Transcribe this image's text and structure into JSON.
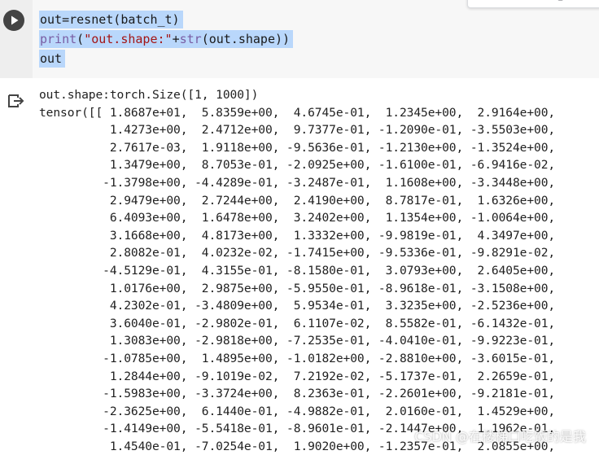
{
  "code_cell": {
    "lines": {
      "l1": "out=resnet(batch_t)",
      "l2a": "print",
      "l2b": "(",
      "l2c": "\"out.shape:\"",
      "l2d": "+",
      "l2e": "str",
      "l2f": "(out.shape))",
      "l3": "out"
    }
  },
  "output": {
    "text": "out.shape:torch.Size([1, 1000])\ntensor([[ 1.8687e+01,  5.8359e+00,  4.6745e-01,  1.2345e+00,  2.9164e+00,\n          1.4273e+00,  2.4712e+00,  9.7377e-01, -1.2090e-01, -3.5503e+00,\n          2.7617e-03,  1.9118e+00, -9.5636e-01, -1.2130e+00, -1.3524e+00,\n          1.3479e+00,  8.7053e-01, -2.0925e+00, -1.6100e-01, -6.9416e-02,\n         -1.3798e+00, -4.4289e-01, -3.2487e-01,  1.1608e+00, -3.3448e+00,\n          2.9479e+00,  2.7244e+00,  2.4190e+00,  8.7817e-01,  1.6326e+00,\n          6.4093e+00,  1.6478e+00,  3.2402e+00,  1.1354e+00, -1.0064e+00,\n          3.1668e+00,  4.8173e+00,  1.3332e+00, -9.9819e-01,  4.3497e+00,\n          2.8082e-01,  4.0232e-02, -1.7415e+00, -9.5336e-01, -9.8291e-02,\n         -4.5129e-01,  4.3155e-01, -8.1580e-01,  3.0793e+00,  2.6405e+00,\n          1.0176e+00,  2.9875e+00, -5.9550e-01, -8.9618e-01, -3.1508e+00,\n          4.2302e-01, -3.4809e+00,  5.9534e-01,  3.3235e+00, -2.5236e+00,\n          3.6040e-01, -2.9802e-01,  6.1107e-02,  8.5582e-01, -6.1432e-01,\n          1.3083e+00, -2.9818e+00, -7.2535e-01, -4.0410e-01, -9.9223e-01,\n         -1.0785e+00,  1.4895e+00, -1.0182e+00, -2.8810e+00, -3.6015e-01,\n          1.2844e+00, -9.1019e-02,  7.2192e-02, -5.1737e-01,  2.2659e-01,\n         -1.5983e+00, -3.3724e+00,  8.2363e-01, -2.2601e+00, -9.2181e-01,\n         -2.3625e+00,  6.1440e-01, -4.9882e-01,  2.0160e-01,  1.4529e+00,\n         -1.4149e+00, -5.5418e-01, -8.9601e-01, -2.1447e+00,  1.1962e-01,\n          1.4540e-01, -7.0254e-01,  1.9020e+00, -1.2357e-01,  2.0855e+00,"
  },
  "watermark": "CSDN @在楼梯口吃饭的是我",
  "icons": {
    "run": "play-circle-icon",
    "output": "output-redirect-icon"
  }
}
